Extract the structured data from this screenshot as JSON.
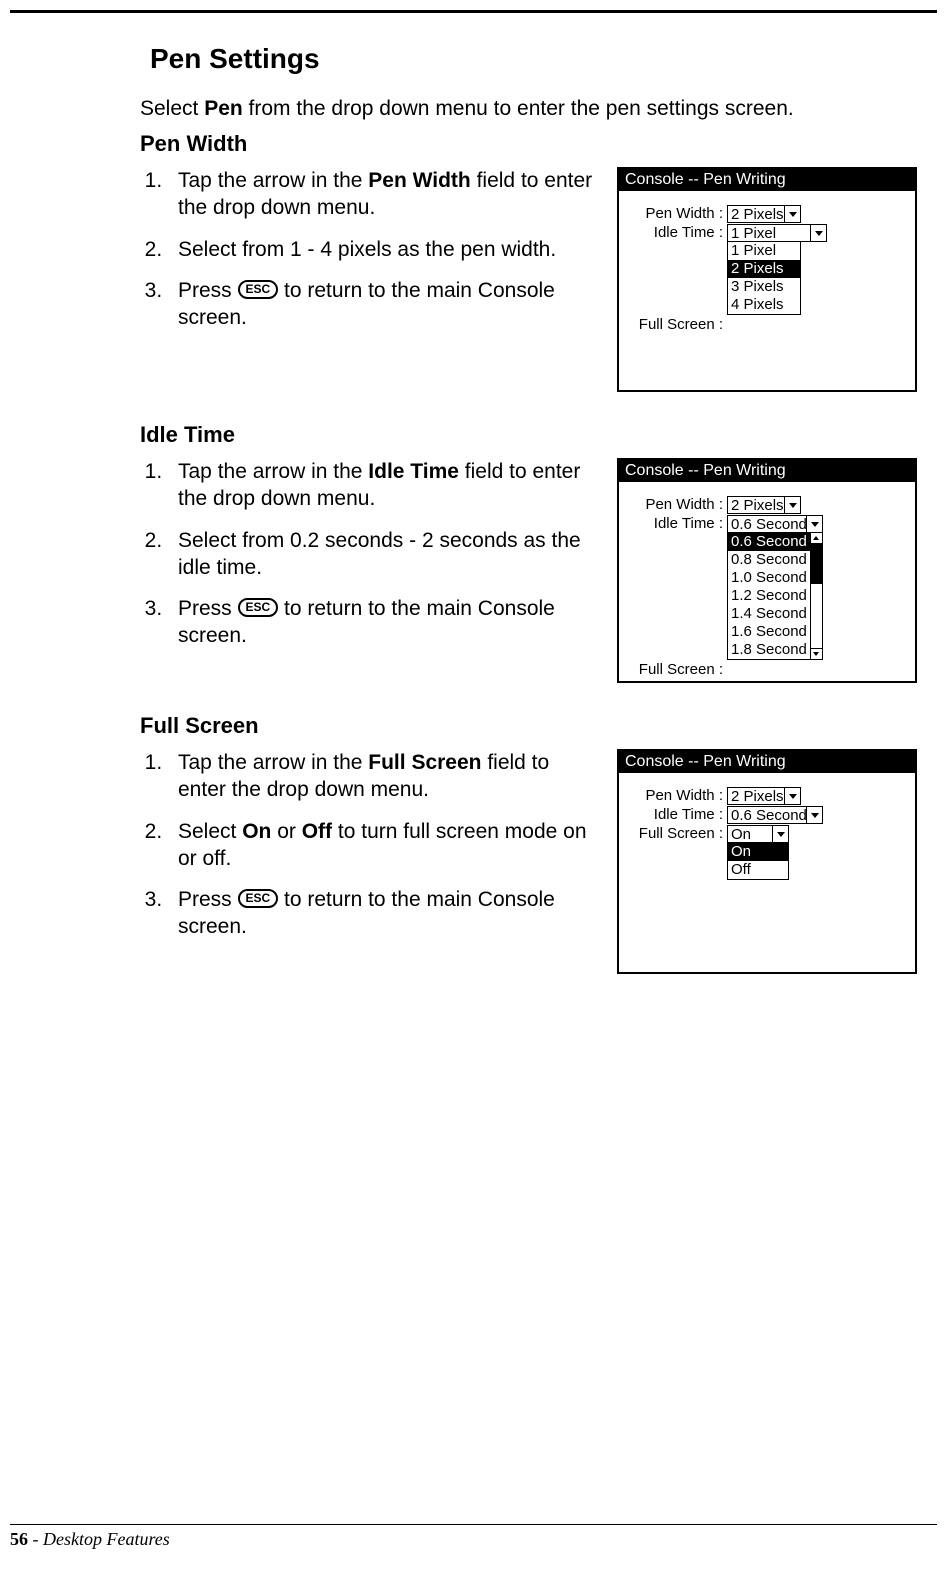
{
  "page": {
    "title": "Pen Settings",
    "intro_pre": "Select ",
    "intro_bold": "Pen",
    "intro_post": " from the drop down menu to enter the pen settings screen.",
    "esc_label": "ESC",
    "footer_page": "56",
    "footer_sep": "  -  ",
    "footer_text": "Desktop Features"
  },
  "sections": {
    "pen_width": {
      "heading": "Pen Width",
      "step1_pre": "Tap the arrow in the ",
      "step1_bold": "Pen Width",
      "step1_post": " field to enter the drop down menu.",
      "step2": "Select from 1 - 4 pixels as the pen width.",
      "step3_pre": "Press ",
      "step3_post": " to return to the main Console screen."
    },
    "idle_time": {
      "heading": "Idle Time",
      "step1_pre": "Tap the arrow in the ",
      "step1_bold": "Idle Time",
      "step1_post": " field to enter the drop down menu.",
      "step2": "Select from 0.2 seconds - 2 seconds as the idle time.",
      "step3_pre": "Press ",
      "step3_post": " to return to the main Console screen."
    },
    "full_screen": {
      "heading": "Full Screen",
      "step1_pre": "Tap the arrow in the ",
      "step1_bold": "Full Screen",
      "step1_post": " field to enter the drop down menu.",
      "step2_pre": "Select ",
      "step2_b1": "On",
      "step2_mid": " or ",
      "step2_b2": "Off",
      "step2_post": " to turn full screen mode on or off.",
      "step3_pre": "Press ",
      "step3_post": " to return to the main Console screen."
    }
  },
  "console": {
    "title": "Console -- Pen Writing",
    "labels": {
      "pen_width": "Pen Width :",
      "idle_time": "Idle Time :",
      "full_screen": "Full Screen :"
    },
    "fig1": {
      "pen_width_value": "2 Pixels",
      "idle_time_value": "1 Pixel",
      "options": [
        "1 Pixel",
        "2 Pixels",
        "3 Pixels",
        "4 Pixels"
      ],
      "selected": "2 Pixels"
    },
    "fig2": {
      "pen_width_value": "2 Pixels",
      "idle_time_value": "0.6 Second",
      "options": [
        "0.6 Second",
        "0.8 Second",
        "1.0 Second",
        "1.2 Second",
        "1.4 Second",
        "1.6 Second",
        "1.8 Second"
      ],
      "selected": "0.6 Second"
    },
    "fig3": {
      "pen_width_value": "2 Pixels",
      "idle_time_value": "0.6 Second",
      "full_screen_value": "On",
      "options": [
        "On",
        "Off"
      ],
      "selected": "On"
    }
  }
}
